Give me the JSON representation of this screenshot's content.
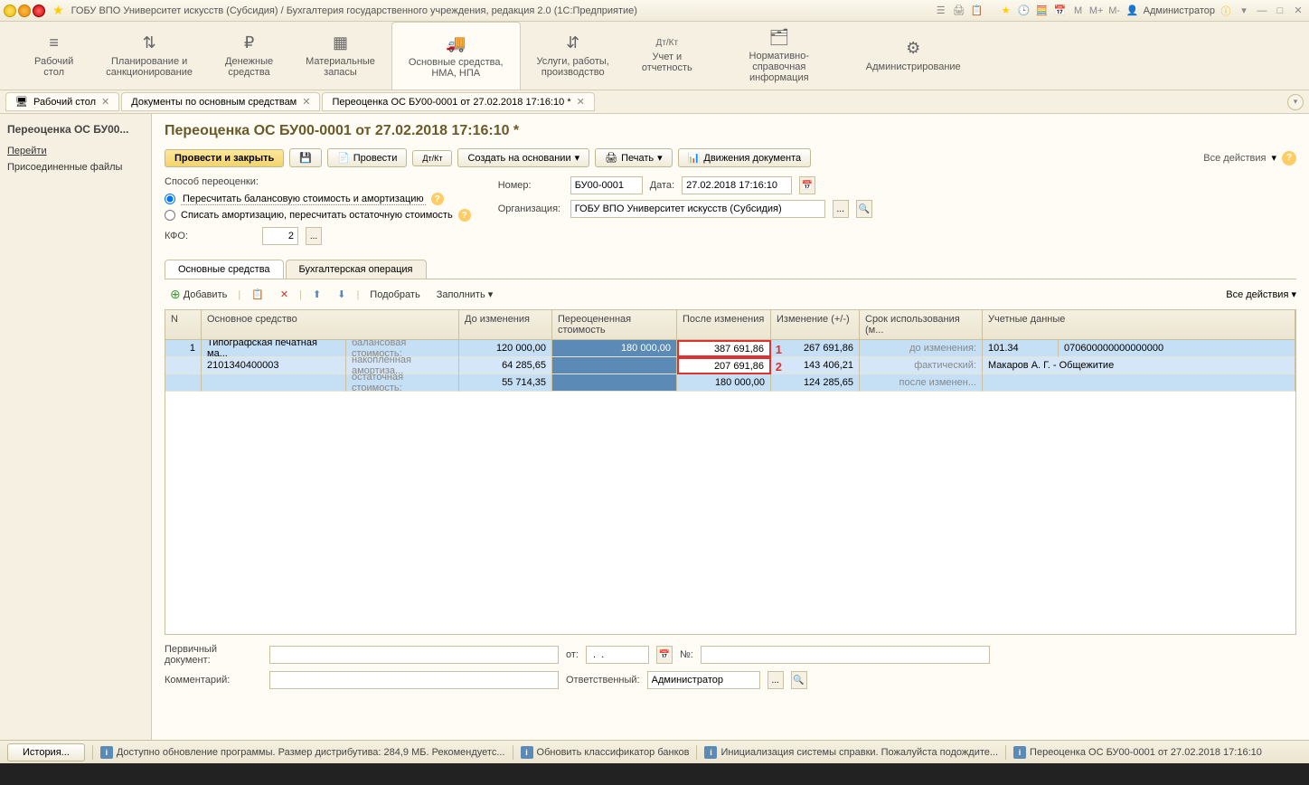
{
  "titlebar": {
    "title": "ГОБУ ВПО Университет искусств (Субсидия) / Бухгалтерия государственного учреждения, редакция 2.0  (1С:Предприятие)",
    "user": "Администратор",
    "m_labels": [
      "M",
      "M+",
      "M-"
    ]
  },
  "mainnav": [
    {
      "icon": "≡",
      "label": "Рабочий\nстол"
    },
    {
      "icon": "⇅",
      "label": "Планирование и\nсанкционирование"
    },
    {
      "icon": "₽",
      "label": "Денежные\nсредства"
    },
    {
      "icon": "▦",
      "label": "Материальные\nзапасы"
    },
    {
      "icon": "🚚",
      "label": "Основные средства,\nНМА, НПА"
    },
    {
      "icon": "⇵",
      "label": "Услуги, работы,\nпроизводство"
    },
    {
      "icon": "Дт/Кт",
      "label": "Учет и\nотчетность"
    },
    {
      "icon": "🗂",
      "label": "Нормативно-справочная\nинформация"
    },
    {
      "icon": "⚙",
      "label": "Администрирование"
    }
  ],
  "tabs": [
    {
      "label": "Рабочий стол"
    },
    {
      "label": "Документы по основным средствам"
    },
    {
      "label": "Переоценка ОС БУ00-0001 от 27.02.2018 17:16:10 *"
    }
  ],
  "sidebar": {
    "title": "Переоценка ОС БУ00...",
    "links": [
      "Перейти",
      "Присоединенные файлы"
    ]
  },
  "doc": {
    "title": "Переоценка ОС БУ00-0001 от 27.02.2018 17:16:10 *",
    "toolbar": {
      "post_close": "Провести и закрыть",
      "post": "Провести",
      "create_based": "Создать на основании",
      "print": "Печать",
      "movements": "Движения документа",
      "all_actions": "Все действия"
    },
    "method_label": "Способ переоценки:",
    "radio1": "Пересчитать балансовую стоимость и амортизацию",
    "radio2": "Списать амортизацию, пересчитать остаточную стоимость",
    "number_label": "Номер:",
    "number": "БУ00-0001",
    "date_label": "Дата:",
    "date": "27.02.2018 17:16:10",
    "org_label": "Организация:",
    "org": "ГОБУ ВПО Университет искусств (Субсидия)",
    "kfo_label": "КФО:",
    "kfo": "2",
    "doc_tabs": [
      "Основные средства",
      "Бухгалтерская операция"
    ],
    "table_toolbar": {
      "add": "Добавить",
      "select": "Подобрать",
      "fill": "Заполнить",
      "all_actions": "Все действия"
    },
    "table": {
      "headers": {
        "n": "N",
        "os": "Основное средство",
        "before": "До изменения",
        "revalued": "Переоцененная стоимость",
        "after": "После изменения",
        "change": "Изменение (+/-)",
        "usage": "Срок использования (м...",
        "acc": "Учетные данные"
      },
      "rows": [
        {
          "n": "1",
          "os": "Типографская печатная ма...",
          "os2": "2101340400003",
          "labels": [
            "балансовая стоимость:",
            "накопленная амортиза...",
            "остаточная стоимость:"
          ],
          "before": [
            "120 000,00",
            "64 285,65",
            "55 714,35"
          ],
          "revalued": [
            "180 000,00",
            "",
            ""
          ],
          "after": [
            "387 691,86",
            "207 691,86",
            "180 000,00"
          ],
          "change": [
            "267 691,86",
            "143 406,21",
            "124 285,65"
          ],
          "usage_labels": [
            "до изменения:",
            "фактический:",
            "после изменен..."
          ],
          "acc_a": [
            "101.34",
            "Макаров А. Г. - Общежитие"
          ],
          "acc_b": "070600000000000000"
        }
      ],
      "annotations": [
        "1",
        "2"
      ]
    },
    "bottom": {
      "primary_doc": "Первичный документ:",
      "from": "от:",
      "from_value": " .  .",
      "num": "№:",
      "comment": "Комментарий:",
      "responsible": "Ответственный:",
      "responsible_value": "Администратор"
    }
  },
  "statusbar": {
    "history": "История...",
    "items": [
      "Доступно обновление программы. Размер дистрибутива: 284,9 МБ. Рекомендуетс...",
      "Обновить классификатор банков",
      "Инициализация системы справки. Пожалуйста подождите...",
      "Переоценка ОС БУ00-0001 от 27.02.2018 17:16:10"
    ]
  }
}
